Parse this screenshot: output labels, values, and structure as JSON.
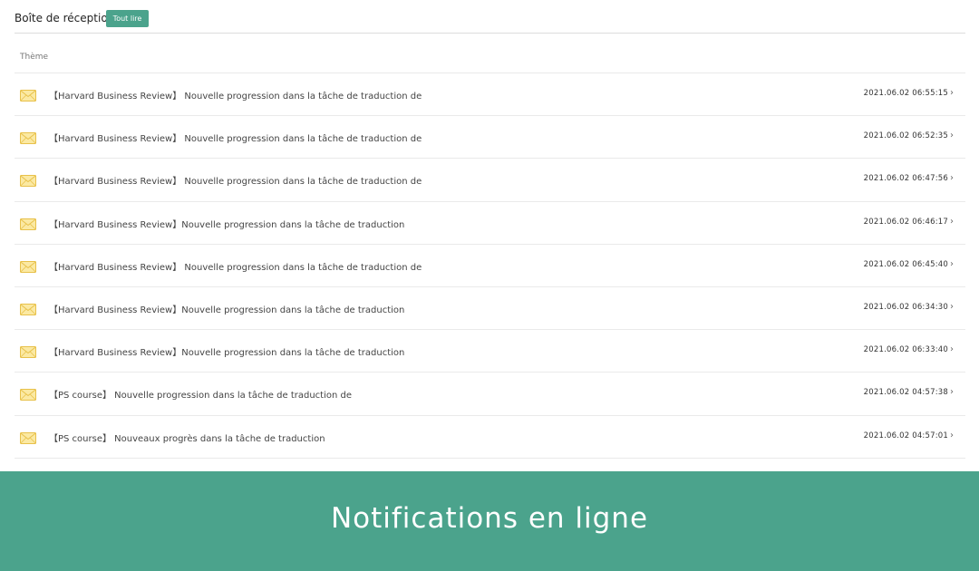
{
  "header": {
    "title": "Boîte de réception",
    "read_all_label": "Tout lire"
  },
  "table": {
    "column_subject": "Thème"
  },
  "messages": [
    {
      "subject": "【Harvard Business Review】 Nouvelle progression dans la tâche de traduction de",
      "date": "2021.06.02 06:55:15"
    },
    {
      "subject": "【Harvard Business Review】 Nouvelle progression dans la tâche de traduction de",
      "date": "2021.06.02 06:52:35"
    },
    {
      "subject": "【Harvard Business Review】 Nouvelle progression dans la tâche de traduction de",
      "date": "2021.06.02 06:47:56"
    },
    {
      "subject": "【Harvard Business Review】Nouvelle progression dans la tâche de traduction",
      "date": "2021.06.02 06:46:17"
    },
    {
      "subject": "【Harvard Business Review】 Nouvelle progression dans la tâche de traduction de",
      "date": "2021.06.02 06:45:40"
    },
    {
      "subject": "【Harvard Business Review】Nouvelle progression dans la tâche de traduction",
      "date": "2021.06.02 06:34:30"
    },
    {
      "subject": "【Harvard Business Review】Nouvelle progression dans la tâche de traduction",
      "date": "2021.06.02 06:33:40"
    },
    {
      "subject": "【PS course】 Nouvelle progression dans la tâche de traduction de",
      "date": "2021.06.02 04:57:38"
    },
    {
      "subject": "【PS course】 Nouveaux progrès dans la tâche de traduction",
      "date": "2021.06.02 04:57:01"
    }
  ],
  "icons": {
    "message": "envelope-icon",
    "open": "chevron-right-icon"
  },
  "banner": {
    "text": "Notifications en ligne"
  },
  "colors": {
    "accent": "#4ba38c",
    "envelope_fill": "#fbe9a3",
    "envelope_stroke": "#e8c14a"
  }
}
